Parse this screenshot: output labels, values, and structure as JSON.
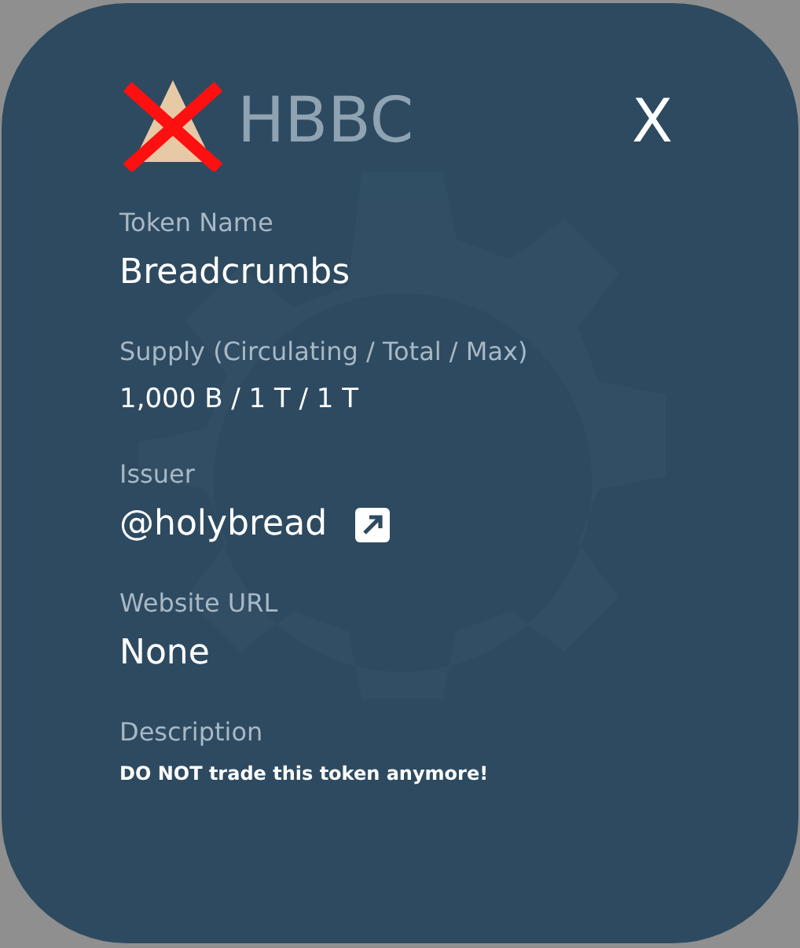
{
  "token": {
    "symbol": "HBBC",
    "delisted": true
  },
  "close": {
    "label": "X"
  },
  "fields": [
    {
      "label": "Token Name",
      "value": "Breadcrumbs",
      "kind": "large"
    },
    {
      "label": "Supply (Circulating / Total / Max)",
      "value": "1,000 B / 1 T / 1 T",
      "kind": "medium"
    },
    {
      "label": "Issuer",
      "value": "@holybread",
      "kind": "link"
    },
    {
      "label": "Website URL",
      "value": "None",
      "kind": "large"
    },
    {
      "label": "Description",
      "value": "DO NOT trade this token anymore!",
      "kind": "note"
    }
  ]
}
